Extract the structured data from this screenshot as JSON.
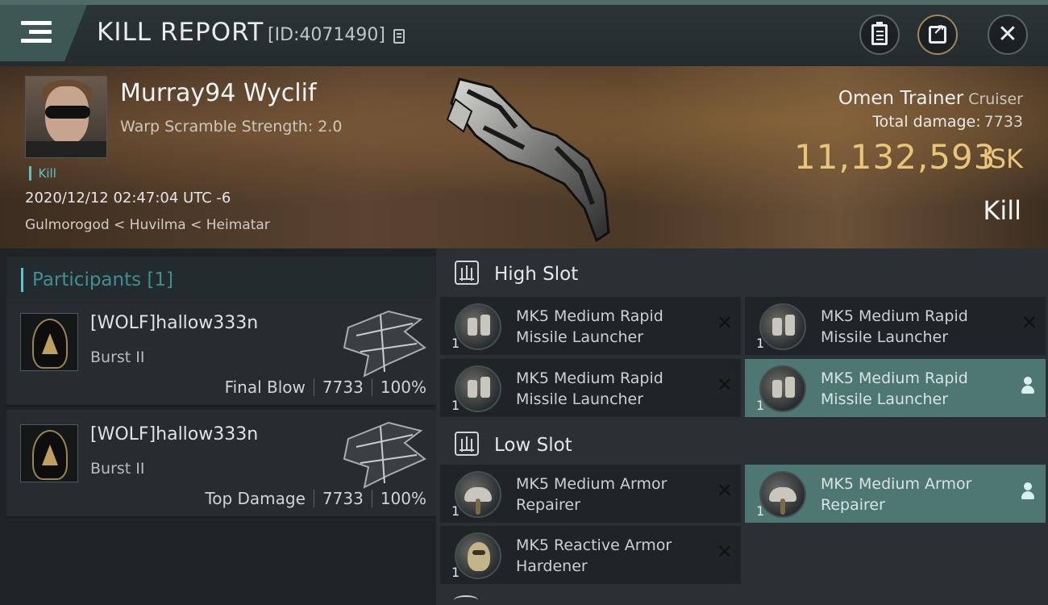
{
  "header": {
    "title": "KILL REPORT",
    "report_id": "[ID:4071490]"
  },
  "victim": {
    "name": "Murray94 Wyclif",
    "warp_scramble": "Warp Scramble Strength: 2.0",
    "kill_tag": "Kill",
    "timestamp": "2020/12/12 02:47:04 UTC -6",
    "location": "Gulmorogod < Huvilma < Heimatar",
    "ship_name": "Omen Trainer",
    "ship_class": "Cruiser",
    "total_damage_label": "Total damage:",
    "total_damage": "7733",
    "isk_value": "11,132,593",
    "isk_unit": "ISK",
    "result": "Kill"
  },
  "participants": {
    "title": "Participants [1]",
    "items": [
      {
        "name": "[WOLF]hallow333n",
        "ship": "Burst II",
        "role": "Final Blow",
        "damage": "7733",
        "percent": "100%"
      },
      {
        "name": "[WOLF]hallow333n",
        "ship": "Burst II",
        "role": "Top Damage",
        "damage": "7733",
        "percent": "100%"
      }
    ]
  },
  "fitting": {
    "high_slot_title": "High Slot",
    "low_slot_title": "Low Slot",
    "high": [
      {
        "name": "MK5 Medium Rapid Missile Launcher",
        "qty": "1",
        "state": "destroyed"
      },
      {
        "name": "MK5 Medium Rapid Missile Launcher",
        "qty": "1",
        "state": "destroyed"
      },
      {
        "name": "MK5 Medium Rapid Missile Launcher",
        "qty": "1",
        "state": "destroyed"
      },
      {
        "name": "MK5 Medium Rapid Missile Launcher",
        "qty": "1",
        "state": "dropped"
      }
    ],
    "low": [
      {
        "name": "MK5 Medium Armor Repairer",
        "qty": "1",
        "state": "destroyed"
      },
      {
        "name": "MK5 Medium Armor Repairer",
        "qty": "1",
        "state": "dropped"
      },
      {
        "name": "MK5 Reactive Armor Hardener",
        "qty": "1",
        "state": "destroyed"
      }
    ],
    "icons": {
      "destroyed": "close-icon",
      "dropped": "person-icon"
    }
  },
  "colors": {
    "accent_teal": "#5ec4c9",
    "isk_gold": "#e9c57a",
    "highlight_row": "#4e7672"
  }
}
